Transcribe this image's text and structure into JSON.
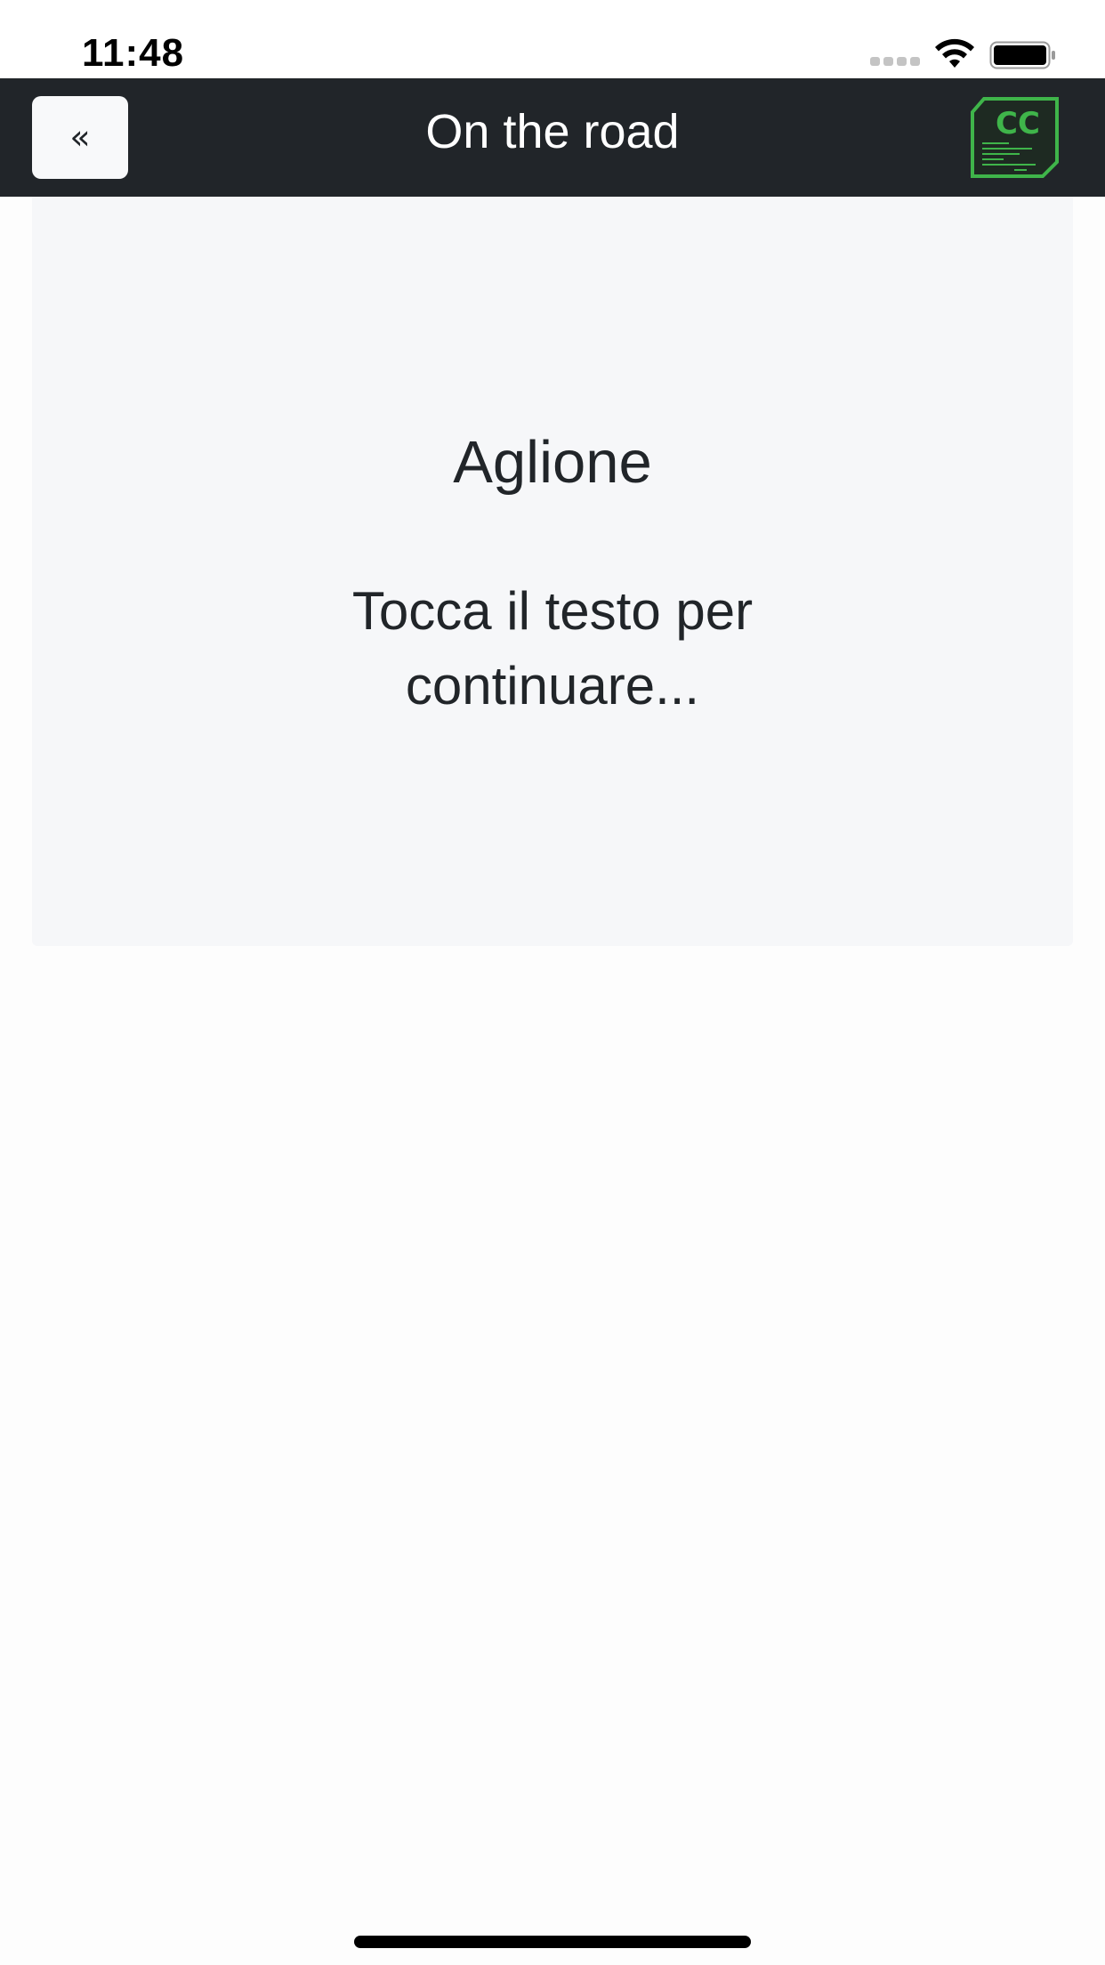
{
  "status_bar": {
    "time": "11:48",
    "signal_icon": "cellular-signal-icon",
    "wifi_icon": "wifi-icon",
    "battery_icon": "battery-full-icon"
  },
  "nav": {
    "back_label": "«",
    "title": "On the road",
    "logo_text": "CC",
    "logo_color": "#3fb54a"
  },
  "card": {
    "title": "Aglione",
    "prompt": "Tocca il testo per continuare..."
  },
  "colors": {
    "nav_background": "#212529",
    "card_background": "#f6f7f9",
    "text": "#212529"
  }
}
